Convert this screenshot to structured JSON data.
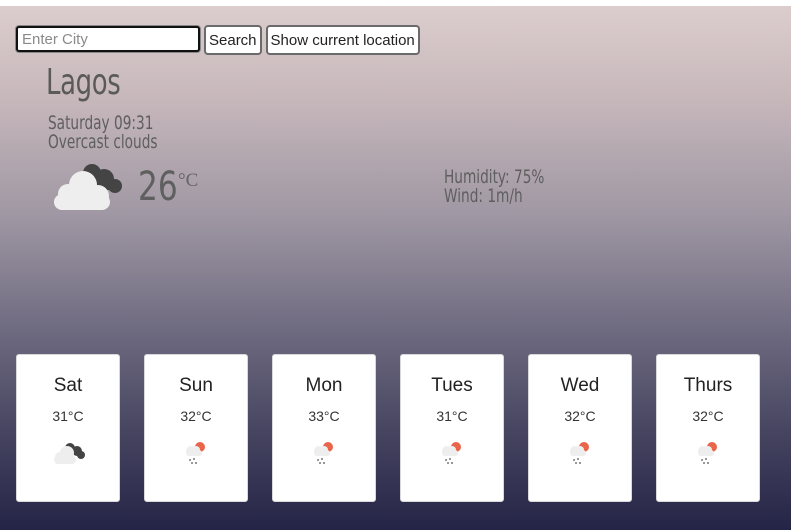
{
  "search": {
    "placeholder": "Enter City",
    "search_label": "Search",
    "location_label": "Show current location"
  },
  "current": {
    "city": "Lagos",
    "datetime": "Saturday 09:31",
    "description": "Overcast clouds",
    "temperature": "26",
    "unit": "°C",
    "humidity": "Humidity: 75%",
    "wind": "Wind: 1m/h",
    "icon": "overcast-clouds-icon"
  },
  "forecast": [
    {
      "day": "Sat",
      "temp": "31°C",
      "icon": "overcast-clouds-icon"
    },
    {
      "day": "Sun",
      "temp": "32°C",
      "icon": "sun-rain-icon"
    },
    {
      "day": "Mon",
      "temp": "33°C",
      "icon": "sun-rain-icon"
    },
    {
      "day": "Tues",
      "temp": "31°C",
      "icon": "sun-rain-icon"
    },
    {
      "day": "Wed",
      "temp": "32°C",
      "icon": "sun-rain-icon"
    },
    {
      "day": "Thurs",
      "temp": "32°C",
      "icon": "sun-rain-icon"
    }
  ],
  "colors": {
    "sun": "#e8654a",
    "cloud_dark": "#444444",
    "cloud_light": "#efefef"
  }
}
